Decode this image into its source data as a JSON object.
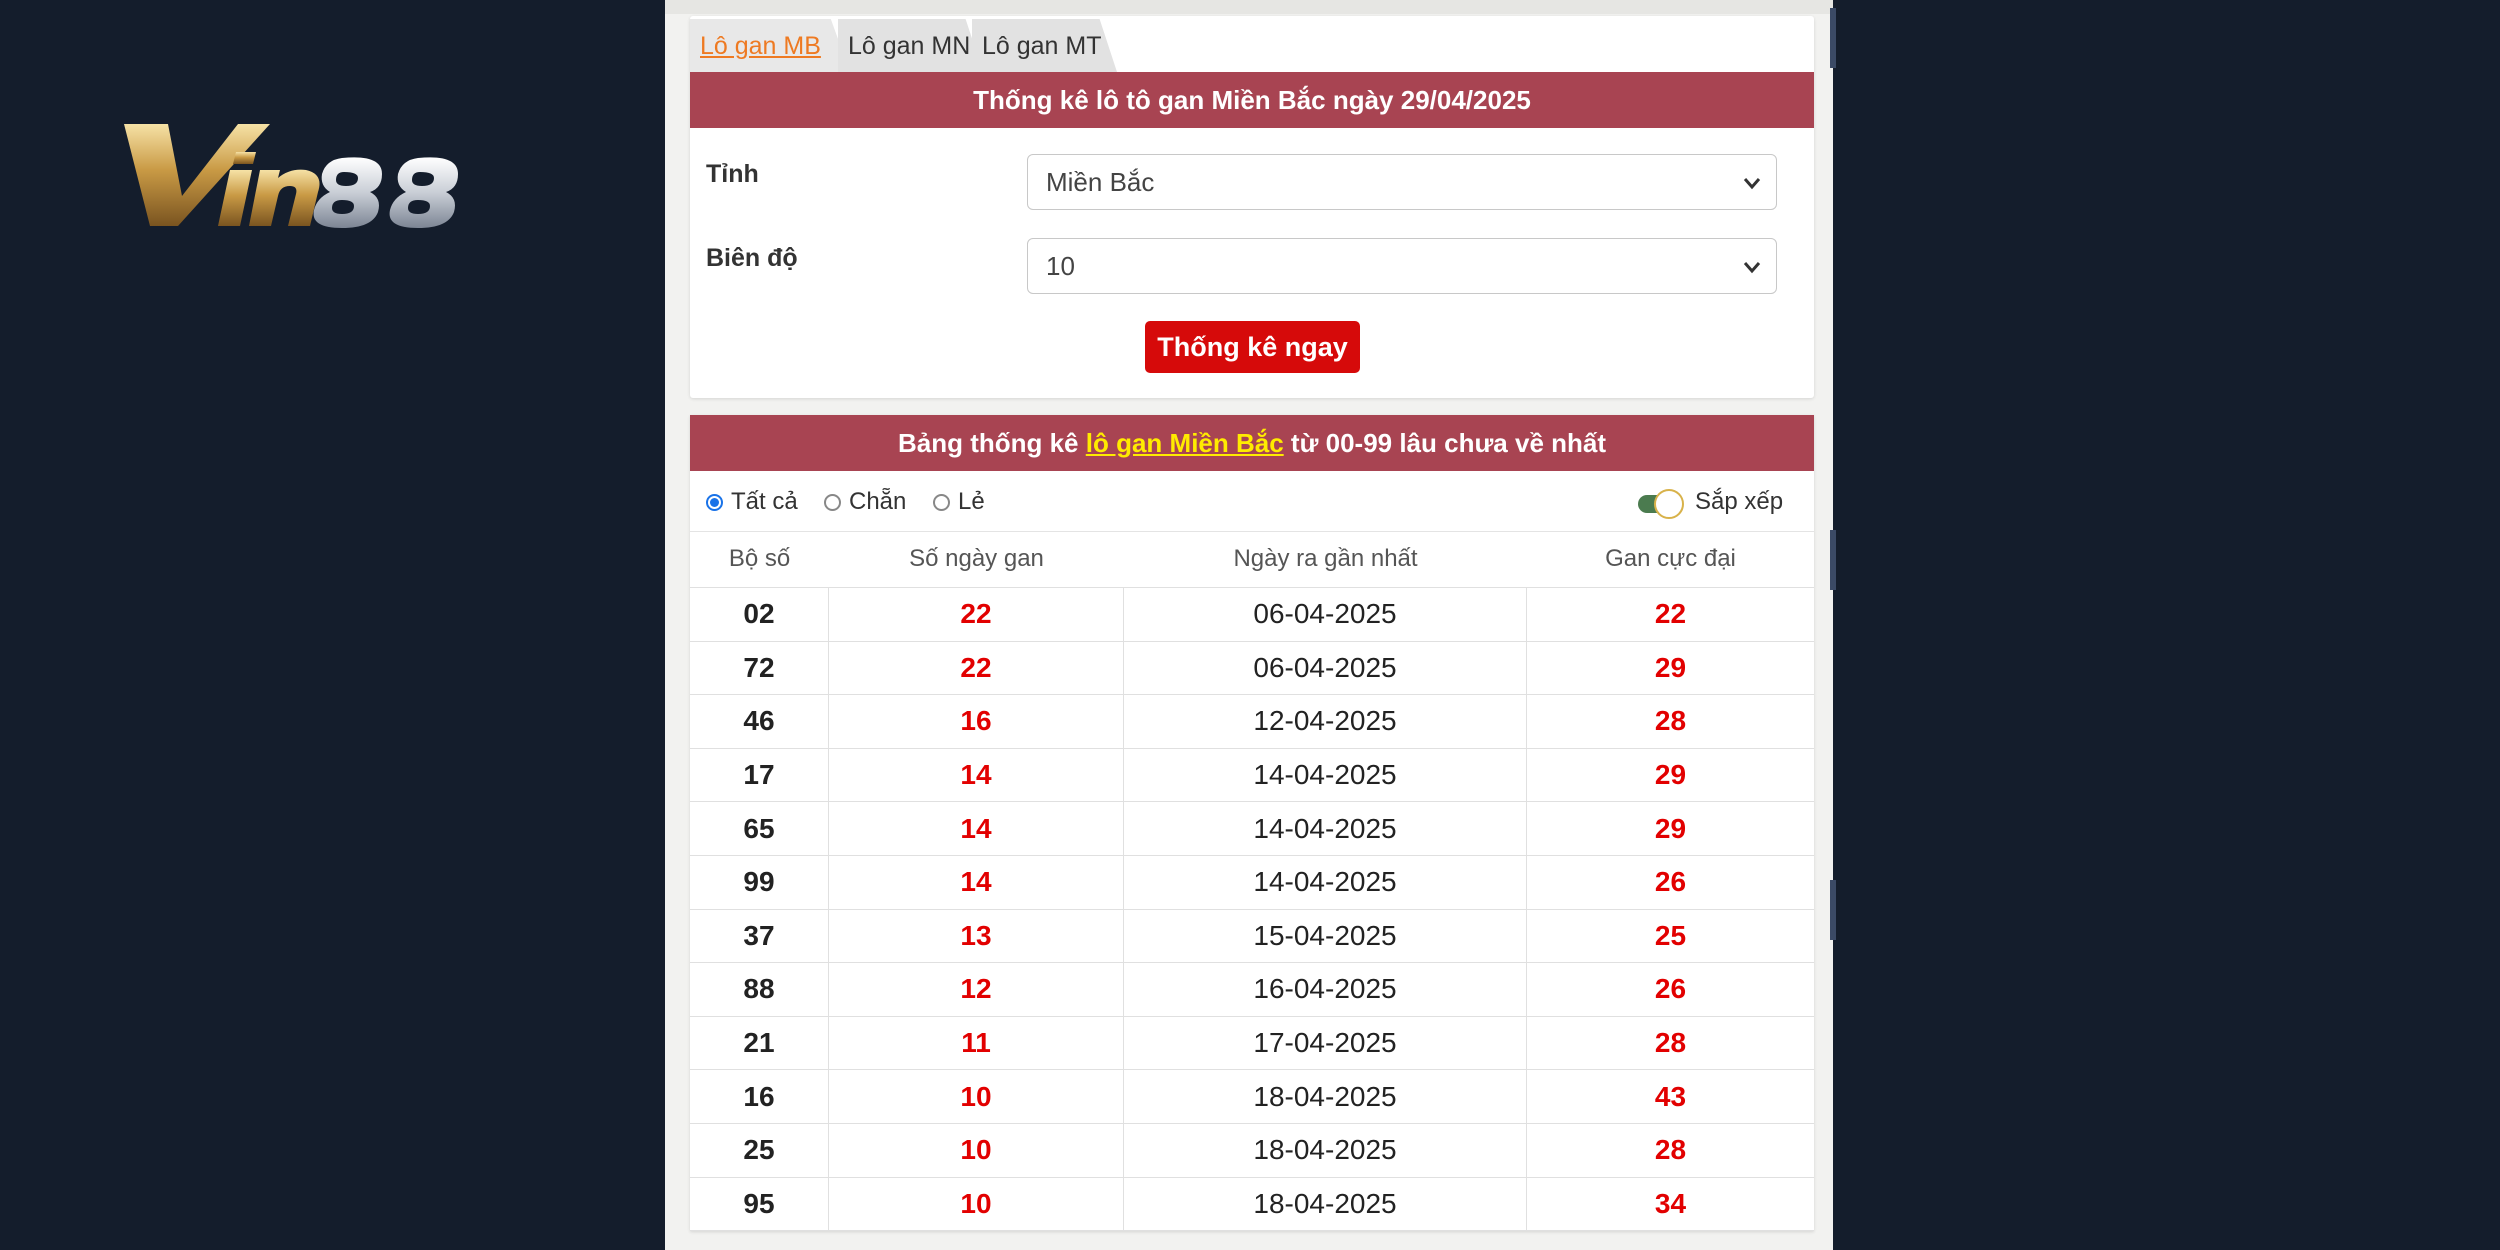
{
  "brand": {
    "logo_text": "Vin88"
  },
  "tabs": [
    {
      "label": "Lô gan MB",
      "active": true
    },
    {
      "label": "Lô gan MN",
      "active": false
    },
    {
      "label": "Lô gan MT",
      "active": false
    }
  ],
  "stats_form": {
    "title": "Thống kê lô tô gan Miền Bắc ngày 29/04/2025",
    "province_label": "Tỉnh",
    "province_value": "Miền Bắc",
    "range_label": "Biên độ",
    "range_value": "10",
    "submit_label": "Thống kê ngay"
  },
  "results": {
    "title_prefix": "Bảng thống kê",
    "title_link": "lô gan Miền Bắc",
    "title_suffix": "từ 00-99 lâu chưa về nhất",
    "filters": [
      {
        "label": "Tất cả",
        "checked": true
      },
      {
        "label": "Chẵn",
        "checked": false
      },
      {
        "label": "Lẻ",
        "checked": false
      }
    ],
    "sort_label": "Sắp xếp",
    "sort_enabled": true,
    "columns": [
      "Bộ số",
      "Số ngày gan",
      "Ngày ra gần nhất",
      "Gan cực đại"
    ],
    "rows": [
      {
        "number": "02",
        "days": "22",
        "last_date": "06-04-2025",
        "max_gan": "22"
      },
      {
        "number": "72",
        "days": "22",
        "last_date": "06-04-2025",
        "max_gan": "29"
      },
      {
        "number": "46",
        "days": "16",
        "last_date": "12-04-2025",
        "max_gan": "28"
      },
      {
        "number": "17",
        "days": "14",
        "last_date": "14-04-2025",
        "max_gan": "29"
      },
      {
        "number": "65",
        "days": "14",
        "last_date": "14-04-2025",
        "max_gan": "29"
      },
      {
        "number": "99",
        "days": "14",
        "last_date": "14-04-2025",
        "max_gan": "26"
      },
      {
        "number": "37",
        "days": "13",
        "last_date": "15-04-2025",
        "max_gan": "25"
      },
      {
        "number": "88",
        "days": "12",
        "last_date": "16-04-2025",
        "max_gan": "26"
      },
      {
        "number": "21",
        "days": "11",
        "last_date": "17-04-2025",
        "max_gan": "28"
      },
      {
        "number": "16",
        "days": "10",
        "last_date": "18-04-2025",
        "max_gan": "43"
      },
      {
        "number": "25",
        "days": "10",
        "last_date": "18-04-2025",
        "max_gan": "28"
      },
      {
        "number": "95",
        "days": "10",
        "last_date": "18-04-2025",
        "max_gan": "34"
      }
    ]
  },
  "colors": {
    "page_background": "#141d2c",
    "banner": "#a84452",
    "highlight": "#ffeb00",
    "button": "#d60a0a",
    "value_red": "#e20000",
    "active_tab": "#ee7a22"
  }
}
